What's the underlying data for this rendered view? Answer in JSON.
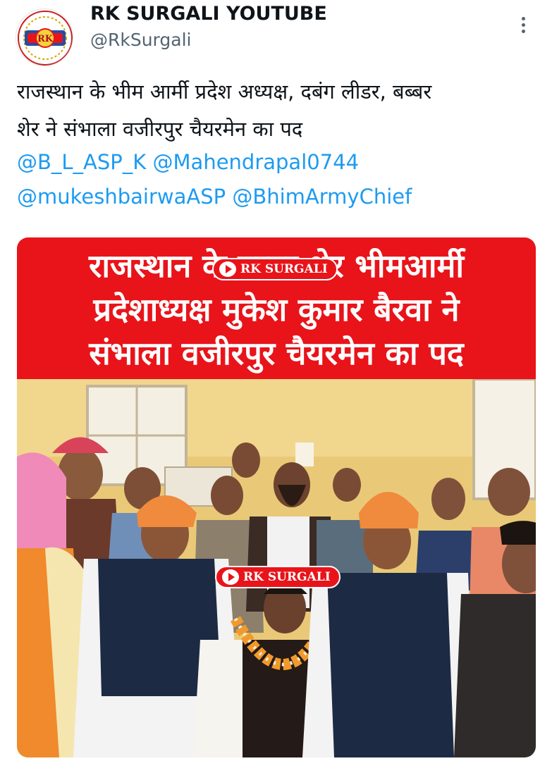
{
  "account": {
    "display_name": "RK SURGALI YOUTUBE",
    "handle": "@RkSurgali",
    "avatar_text": "RK"
  },
  "tweet": {
    "text_line1": "राजस्थान के भीम आर्मी प्रदेश अध्यक्ष, दबंग लीडर, बब्बर",
    "text_line2": "शेर ने संभाला वजीरपुर चैयरमेन का पद",
    "mentions": [
      "@B_L_ASP_K",
      "@Mahendrapal0744",
      "@mukeshbairwaASP",
      "@BhimArmyChief"
    ]
  },
  "media": {
    "banner_line1": "राजस्थान के बब्बर शेर भीमआर्मी",
    "banner_line2": "प्रदेशाध्यक्ष मुकेश कुमार बैरवा ने",
    "banner_line3": "संभाला वजीरपुर चैयरमेन का पद",
    "watermark": "RK SURGALI"
  },
  "colors": {
    "mention": "#1d9bf0",
    "banner_red": "#e8141a",
    "secondary_text": "#536471"
  },
  "icons": {
    "more": "vertical-ellipsis-icon"
  }
}
